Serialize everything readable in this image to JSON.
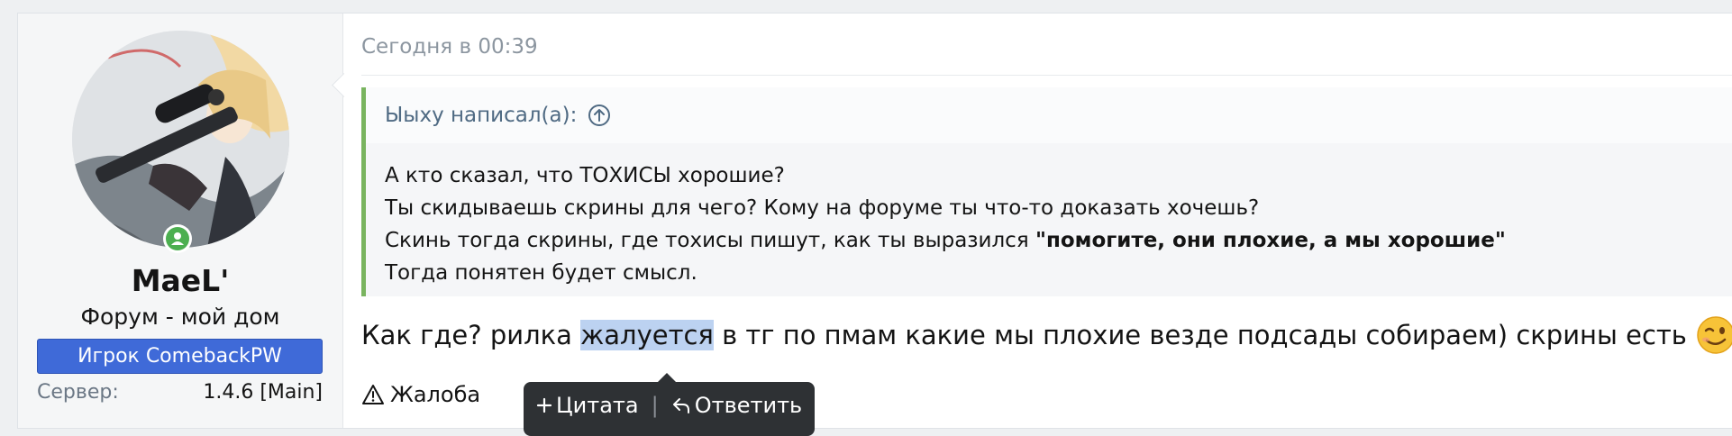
{
  "user": {
    "username": "MaeL'",
    "title": "Форум - мой дом",
    "banner": "Игрок ComebackPW",
    "server_label": "Сервер:",
    "server_value": "1.4.6 [Main]"
  },
  "post": {
    "date": "Сегодня в 00:39",
    "quote": {
      "author": "Ыыху написал(а):",
      "lines": [
        "А кто сказал, что ТОХИСЫ хорошие?",
        "Ты скидываешь скрины для чего? Кому на форуме ты что-то доказать хочешь?",
        "Скинь тогда скрины, где тохисы пишут, как ты выразился",
        "Тогда понятен будет смысл."
      ],
      "bold_fragment": "\"помогите, они плохие, а мы хорошие\""
    },
    "message": {
      "before": "Как где? рилка ",
      "highlight": "жалуется",
      "after": " в тг по пмам какие мы плохие везде подсады собираем) скрины есть"
    },
    "report_label": "Жалоба"
  },
  "selection_toolbar": {
    "quote_label": "Цитата",
    "separator": "|",
    "reply_label": "Ответить"
  },
  "colors": {
    "accent_blue": "#3f6ad8",
    "quote_border": "#79b45f",
    "online_green": "#4caf50",
    "selection": "#bcd2f1",
    "toolbar_bg": "#2e3134"
  },
  "icons": {
    "online": "online-user-icon",
    "quote_jump": "arrow-up-circle-icon",
    "emoji": "wink-emoji-icon",
    "report": "warning-icon",
    "quote_plus": "plus-icon",
    "reply": "reply-arrow-icon"
  }
}
